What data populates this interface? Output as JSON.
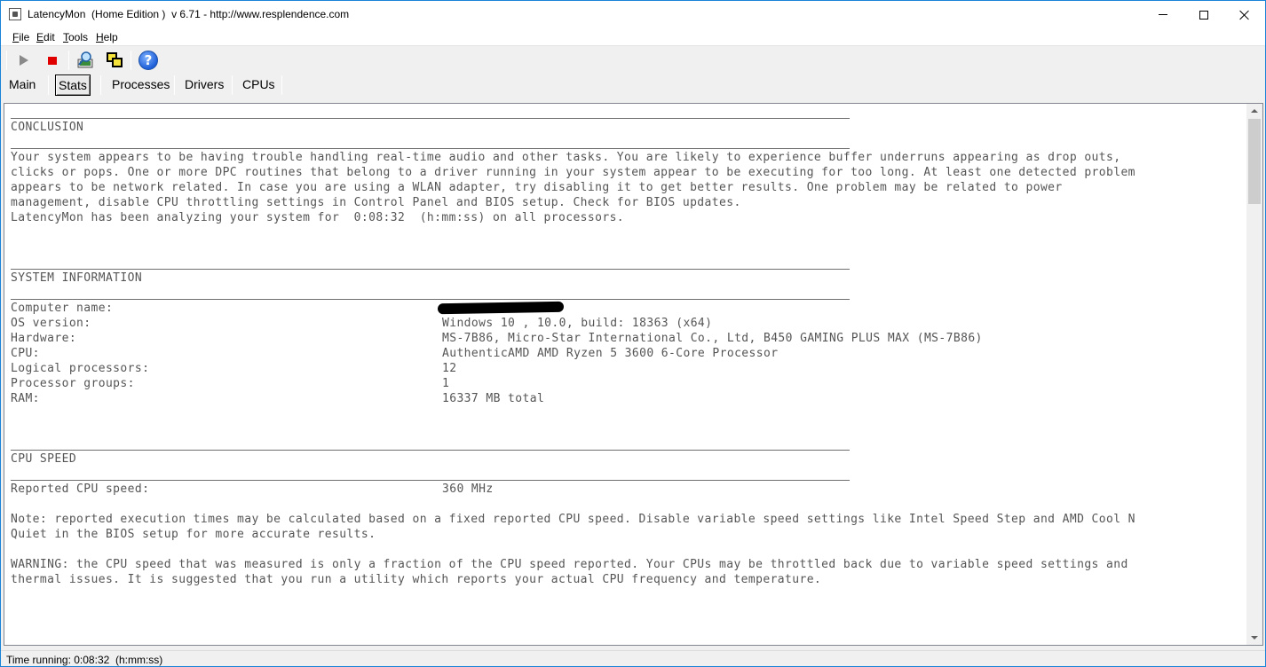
{
  "window": {
    "title": "LatencyMon  (Home Edition )  v 6.71 - http://www.resplendence.com"
  },
  "menu": {
    "file": {
      "first": "F",
      "rest": "ile"
    },
    "edit": {
      "first": "E",
      "rest": "dit"
    },
    "tools": {
      "first": "T",
      "rest": "ools"
    },
    "help": {
      "first": "H",
      "rest": "elp"
    }
  },
  "toolbar": {
    "help_symbol": "?"
  },
  "tabs": {
    "main": "Main",
    "stats": "Stats",
    "processes": "Processes",
    "drivers": "Drivers",
    "cpus": "CPUs",
    "active": "stats"
  },
  "report": {
    "conclusion": {
      "heading": "CONCLUSION",
      "lines": [
        "Your system appears to be having trouble handling real-time audio and other tasks. You are likely to experience buffer underruns appearing as drop outs,",
        "clicks or pops. One or more DPC routines that belong to a driver running in your system appear to be executing for too long. At least one detected problem",
        "appears to be network related. In case you are using a WLAN adapter, try disabling it to get better results. One problem may be related to power",
        "management, disable CPU throttling settings in Control Panel and BIOS setup. Check for BIOS updates.",
        "LatencyMon has been analyzing your system for  0:08:32  (h:mm:ss) on all processors."
      ]
    },
    "system_information": {
      "heading": "SYSTEM INFORMATION",
      "rows": [
        {
          "key": "Computer name:",
          "value": ""
        },
        {
          "key": "OS version:",
          "value": "Windows 10 , 10.0, build: 18363 (x64)"
        },
        {
          "key": "Hardware:",
          "value": "MS-7B86, Micro-Star International Co., Ltd, B450 GAMING PLUS MAX (MS-7B86)"
        },
        {
          "key": "CPU:",
          "value": "AuthenticAMD AMD Ryzen 5 3600 6-Core Processor"
        },
        {
          "key": "Logical processors:",
          "value": "12"
        },
        {
          "key": "Processor groups:",
          "value": "1"
        },
        {
          "key": "RAM:",
          "value": "16337 MB total"
        }
      ]
    },
    "cpu_speed": {
      "heading": "CPU SPEED",
      "reported_key": "Reported CPU speed:",
      "reported_value": "360 MHz",
      "note_lines": [
        "Note: reported execution times may be calculated based on a fixed reported CPU speed. Disable variable speed settings like Intel Speed Step and AMD Cool N",
        "Quiet in the BIOS setup for more accurate results."
      ],
      "warning_lines": [
        "WARNING: the CPU speed that was measured is only a fraction of the CPU speed reported. Your CPUs may be throttled back due to variable speed settings and",
        "thermal issues. It is suggested that you run a utility which reports your actual CPU frequency and temperature."
      ]
    }
  },
  "status": {
    "text": "Time running: 0:08:32  (h:mm:ss)"
  }
}
